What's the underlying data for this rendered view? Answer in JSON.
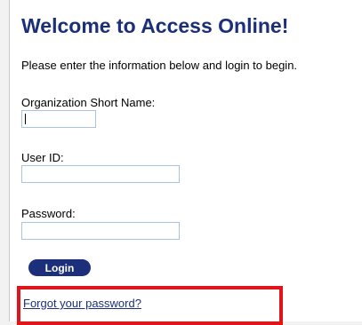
{
  "page": {
    "title": "Welcome to Access Online!",
    "intro": "Please enter the information below and login to begin."
  },
  "form": {
    "org_label": "Organization Short Name:",
    "org_value": "",
    "user_label": "User ID:",
    "user_value": "",
    "password_label": "Password:",
    "password_value": "",
    "login_label": "Login"
  },
  "links": {
    "forgot_password": "Forgot your password?"
  },
  "colors": {
    "title": "#1b2f7a",
    "button": "#1b2f7a",
    "highlight": "#e0141b",
    "field_border": "#a9c3e0"
  }
}
